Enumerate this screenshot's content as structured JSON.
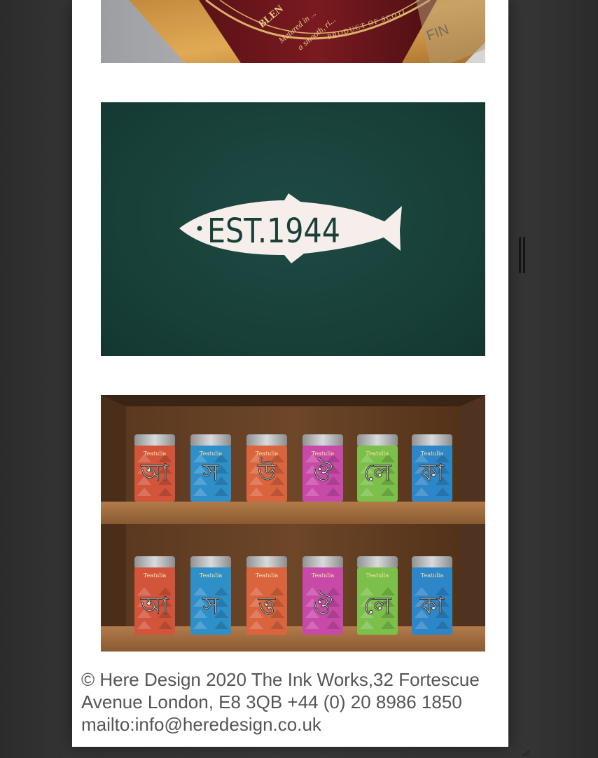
{
  "images": {
    "whisky": {
      "alt": "Blended Scotch whisky bottle label close-up",
      "label_text_1": "BLEN",
      "label_text_2": "Matured in ...",
      "label_text_3": "a smooth, ri...",
      "label_text_4": "PRODUCT OF SCOTL"
    },
    "fish": {
      "alt": "Salmon shaped logo on dark green",
      "logo_text": "EST.1944",
      "background_color": "#184039",
      "logo_color": "#f6eeea"
    },
    "tea": {
      "alt": "Teatulia tea tins on a wooden shelf",
      "brand": "Teatulia",
      "top_row_glyphs": [
        "আ",
        "স",
        "উ",
        "ঔ",
        "লে",
        "কা"
      ],
      "bottom_row_glyphs": [
        "আ",
        "স",
        "ত্ত",
        "ঔ",
        "লে",
        "কা"
      ],
      "tin_colors": [
        "#d2553b",
        "#2f8fc9",
        "#d9643e",
        "#c84aa8",
        "#7cbf4a",
        "#2d86c8"
      ]
    }
  },
  "footer": {
    "text": "© Here Design 2020 The Ink Works,32 Fortescue Avenue London, E8 3QB +44 (0) 20 8986 1850 mailto:info@heredesign.co.uk"
  }
}
